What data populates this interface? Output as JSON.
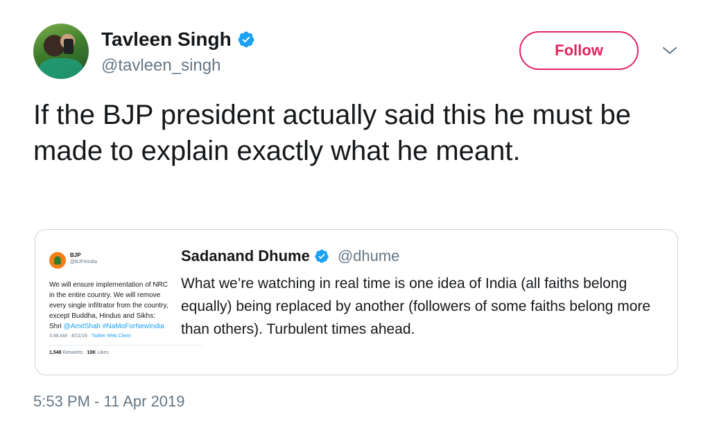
{
  "author": {
    "name": "Tavleen Singh",
    "handle": "@tavleen_singh",
    "verified": true
  },
  "follow_button": {
    "label": "Follow",
    "color": "#e0245e"
  },
  "tweet": {
    "text": "If the BJP president actually said this he must be made to explain exactly what he meant.",
    "timestamp": "5:53 PM - 11 Apr 2019"
  },
  "quoted_tweet": {
    "name": "Sadanand Dhume",
    "handle": "@dhume",
    "verified": true,
    "text": "What we’re watching in real time is one idea of India (all faiths belong equally) being replaced by another (followers of some faiths belong more than others). Turbulent times ahead.",
    "image": {
      "account_name": "BJP",
      "account_handle": "@BJP4India",
      "text_lines": [
        "We will ensure implementation of NRC",
        "in the entire country. We will remove",
        "every single infiltrator from the country,",
        "except Buddha, Hindus and Sikhs:"
      ],
      "text_prefix": "Shri",
      "mention": "@AmitShah",
      "hashtag": "#NaMoForNewIndia",
      "meta_time": "3:48 AM · 4/11/19 ·",
      "meta_source": "Twitter Web Client",
      "retweets_count": "1,548",
      "retweets_label": "Retweets",
      "likes_count": "10K",
      "likes_label": "Likes"
    }
  },
  "colors": {
    "text_primary": "#14171a",
    "text_secondary": "#657786",
    "verified_blue": "#1da1f2",
    "border": "#ccd6dd"
  },
  "icons": {
    "verified": "verified-badge-icon",
    "more": "chevron-down-icon"
  }
}
